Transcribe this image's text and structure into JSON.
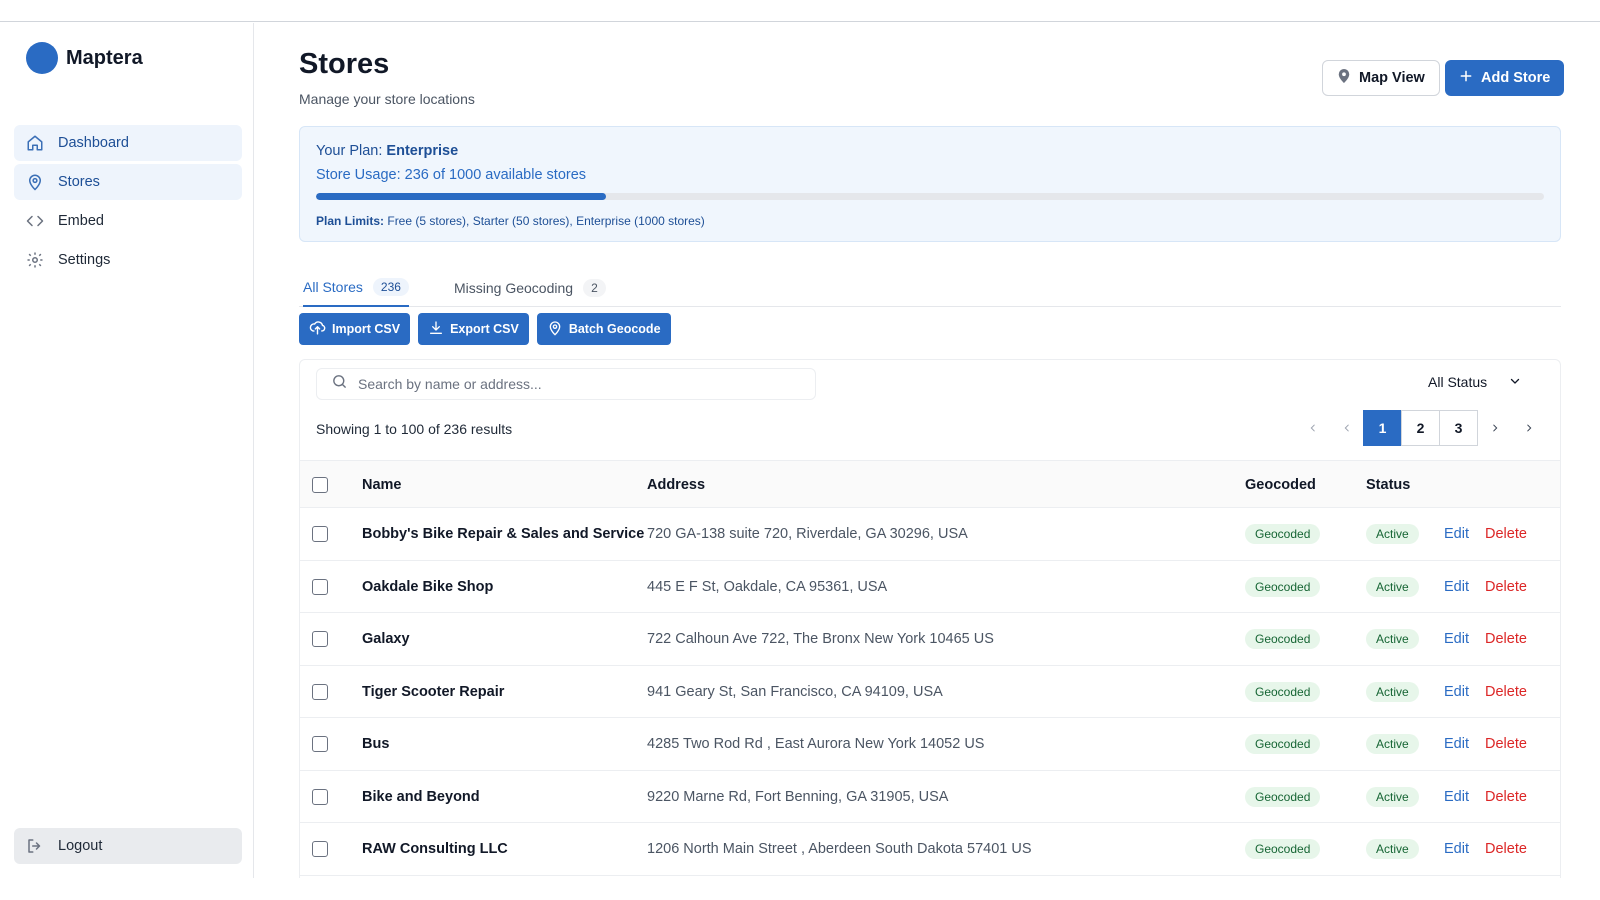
{
  "brand": {
    "name": "Maptera"
  },
  "sidebar": {
    "items": [
      {
        "label": "Dashboard",
        "icon": "home-icon"
      },
      {
        "label": "Stores",
        "icon": "map-pin-icon"
      },
      {
        "label": "Embed",
        "icon": "code-icon"
      },
      {
        "label": "Settings",
        "icon": "gear-icon"
      }
    ],
    "logout": "Logout"
  },
  "header": {
    "title": "Stores",
    "subtitle": "Manage your store locations",
    "map_view": "Map View",
    "add_store": "Add Store"
  },
  "plan": {
    "label": "Your Plan:",
    "name": "Enterprise",
    "usage_text": "Store Usage: 236 of 1000 available stores",
    "used": 236,
    "limit": 1000,
    "limits_label": "Plan Limits:",
    "limits_text": "Free (5 stores), Starter (50 stores), Enterprise (1000 stores)"
  },
  "tabs": [
    {
      "label": "All Stores",
      "count": "236"
    },
    {
      "label": "Missing Geocoding",
      "count": "2"
    }
  ],
  "actions": {
    "import": "Import CSV",
    "export": "Export CSV",
    "batch": "Batch Geocode"
  },
  "search": {
    "placeholder": "Search by name or address..."
  },
  "filter": {
    "status": "All Status"
  },
  "results": {
    "text": "Showing 1 to 100 of 236 results"
  },
  "pagination": {
    "pages": [
      "1",
      "2",
      "3"
    ],
    "current": "1"
  },
  "table": {
    "headers": {
      "name": "Name",
      "address": "Address",
      "geocoded": "Geocoded",
      "status": "Status"
    },
    "edit_label": "Edit",
    "delete_label": "Delete",
    "rows": [
      {
        "name": "Bobby's Bike Repair & Sales and Service",
        "address": "720 GA-138 suite 720, Riverdale, GA 30296, USA",
        "geocoded": "Geocoded",
        "status": "Active"
      },
      {
        "name": "Oakdale Bike Shop",
        "address": "445 E F St, Oakdale, CA 95361, USA",
        "geocoded": "Geocoded",
        "status": "Active"
      },
      {
        "name": "Galaxy",
        "address": "722 Calhoun Ave 722, The Bronx New York 10465 US",
        "geocoded": "Geocoded",
        "status": "Active"
      },
      {
        "name": "Tiger Scooter Repair",
        "address": "941 Geary St, San Francisco, CA 94109, USA",
        "geocoded": "Geocoded",
        "status": "Active"
      },
      {
        "name": "Bus",
        "address": "4285 Two Rod Rd , East Aurora New York 14052 US",
        "geocoded": "Geocoded",
        "status": "Active"
      },
      {
        "name": "Bike and Beyond",
        "address": "9220 Marne Rd, Fort Benning, GA 31905, USA",
        "geocoded": "Geocoded",
        "status": "Active"
      },
      {
        "name": "RAW Consulting LLC",
        "address": "1206 North Main Street , Aberdeen South Dakota 57401 US",
        "geocoded": "Geocoded",
        "status": "Active"
      }
    ]
  },
  "colors": {
    "primary": "#2a6bc3",
    "danger": "#dc2626",
    "success_bg": "#e7f6ea",
    "success_text": "#166534"
  }
}
